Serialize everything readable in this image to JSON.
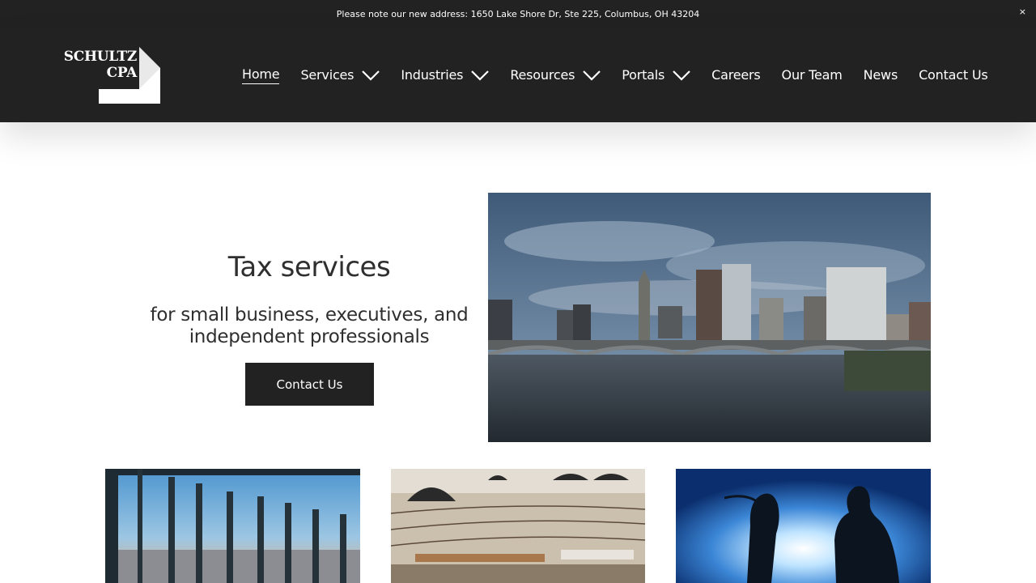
{
  "announcement": {
    "text": "Please note our new address: 1650 Lake Shore Dr, Ste 225, Columbus, OH 43204",
    "close_label": "×"
  },
  "logo": {
    "line1": "SCHULTZ",
    "line2": "CPA"
  },
  "nav": {
    "items": [
      {
        "label": "Home",
        "active": true
      },
      {
        "label": "Services",
        "dropdown": true
      },
      {
        "label": "Industries",
        "dropdown": true
      },
      {
        "label": "Resources",
        "dropdown": true
      },
      {
        "label": "Portals",
        "dropdown": true
      },
      {
        "label": "Careers"
      },
      {
        "label": "Our Team"
      },
      {
        "label": "News"
      },
      {
        "label": "Contact Us"
      }
    ]
  },
  "hero": {
    "title": "Tax services",
    "subtitle": "for small business, executives, and independent professionals",
    "cta_label": "Contact Us"
  },
  "colors": {
    "header_bg": "#222222",
    "text_dark": "#2f2f2f",
    "button_bg": "#222222"
  }
}
